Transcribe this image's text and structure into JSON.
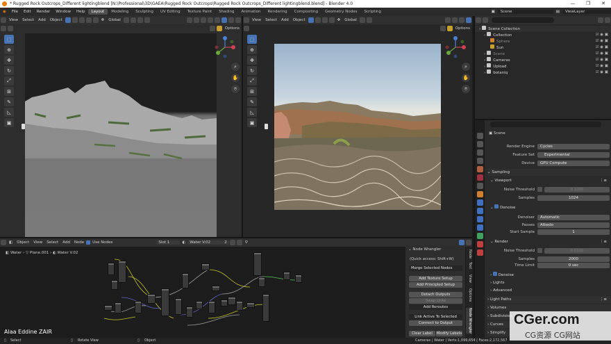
{
  "window": {
    "title": "* Rugged Rock Outcrops_Different lightingblend [N:\\Professional\\3D\\GAEA\\Rugged Rock Outcrops\\Rugged Rock Outcrops_Different lightingblend.blend] - Blender 4.0",
    "controls": [
      "—",
      "❐",
      "✕"
    ]
  },
  "menubar": {
    "menus": [
      "File",
      "Edit",
      "Render",
      "Window",
      "Help"
    ],
    "workspaces": [
      "Layout",
      "Modeling",
      "Sculpting",
      "UV Editing",
      "Texture Paint",
      "Shading",
      "Animation",
      "Rendering",
      "Compositing",
      "Geometry Nodes",
      "Scripting"
    ],
    "active_workspace": "Layout",
    "scene": "Scene",
    "view_layer": "ViewLayer"
  },
  "viewport_left": {
    "menus": [
      "View",
      "Select",
      "Add",
      "Object"
    ],
    "orientation": "Global",
    "options": "Options"
  },
  "viewport_right": {
    "menus": [
      "View",
      "Select",
      "Add",
      "Object"
    ],
    "orientation": "Global",
    "options": "Options"
  },
  "outliner": {
    "rows": [
      {
        "label": "Scene Collection",
        "indent": 0,
        "icon": "collection-icon",
        "dim": false
      },
      {
        "label": "Collection",
        "indent": 1,
        "icon": "collection-icon",
        "dim": false
      },
      {
        "label": "Sphere",
        "indent": 2,
        "icon": "object-icon",
        "dim": true
      },
      {
        "label": "Sun",
        "indent": 2,
        "icon": "light-icon",
        "dim": false
      },
      {
        "label": "Scene",
        "indent": 1,
        "icon": "collection-icon",
        "dim": true
      },
      {
        "label": "Cameras",
        "indent": 1,
        "icon": "collection-icon",
        "dim": false
      },
      {
        "label": "Upload",
        "indent": 1,
        "icon": "collection-icon",
        "dim": false
      },
      {
        "label": "botaniq",
        "indent": 1,
        "icon": "collection-icon",
        "dim": false
      }
    ]
  },
  "properties": {
    "context": "Scene",
    "render_engine_label": "Render Engine",
    "render_engine": "Cycles",
    "feature_set_label": "Feature Set",
    "feature_set": "Experimental",
    "device_label": "Device",
    "device": "GPU Compute",
    "sampling": "Sampling",
    "viewport": "Viewport",
    "noise_threshold_label": "Noise Threshold",
    "viewport_noise_threshold": "0.1000",
    "samples_label": "Samples",
    "viewport_samples": "1024",
    "denoise": "Denoise",
    "denoiser_label": "Denoiser",
    "denoiser": "Automatic",
    "passes_label": "Passes",
    "passes": "Albedo",
    "start_sample_label": "Start Sample",
    "start_sample": "1",
    "render": "Render",
    "render_noise_threshold": "0.0100",
    "render_samples": "2000",
    "time_limit_label": "Time Limit",
    "time_limit": "0 sec",
    "render_denoise": "Denoise",
    "lights": "Lights",
    "advanced": "Advanced",
    "light_paths": "Light Paths",
    "volumes": "Volumes",
    "subdivision": "Subdivision",
    "curves": "Curves",
    "simplify": "Simplify"
  },
  "node_editor": {
    "editor_type": "Object",
    "menus": [
      "View",
      "Select",
      "Add",
      "Node"
    ],
    "use_nodes": "Use Nodes",
    "slot": "Slot 1",
    "material": "Water V.02",
    "material_users": "2",
    "breadcrumb": [
      "Water",
      "Plane.001",
      "Water V.02"
    ],
    "watermark": "Alaa Eddine ZAIR",
    "sidebar_tabs": [
      "Node",
      "Tool",
      "View",
      "Options",
      "Node Wrangler"
    ]
  },
  "node_wrangler": {
    "title": "Node Wrangler",
    "quick_access": "(Quick access: Shift+W)",
    "merge_selected": "Merge Selected Nodes",
    "add_texture_setup": "Add Texture Setup",
    "add_principled_setup": "Add Principled Setup",
    "detach_outputs": "Detach Outputs",
    "swap_links": "Swap Links",
    "add_reroutes": "Add Reroutes",
    "link_active_to_selected": "Link Active To Selected",
    "connect_to_output": "Connect to Output",
    "clear_label": "Clear Label",
    "modify_labels": "Modify Labels"
  },
  "statusbar": {
    "select": "Select",
    "rotate_view": "Rotate View",
    "object": "Object",
    "stats": "Cameras | Water | Verts:1,099,654 | Faces:2,172,567"
  },
  "watermark_site": {
    "main": "CGer.com",
    "sub": "CG资源 CG网站"
  }
}
